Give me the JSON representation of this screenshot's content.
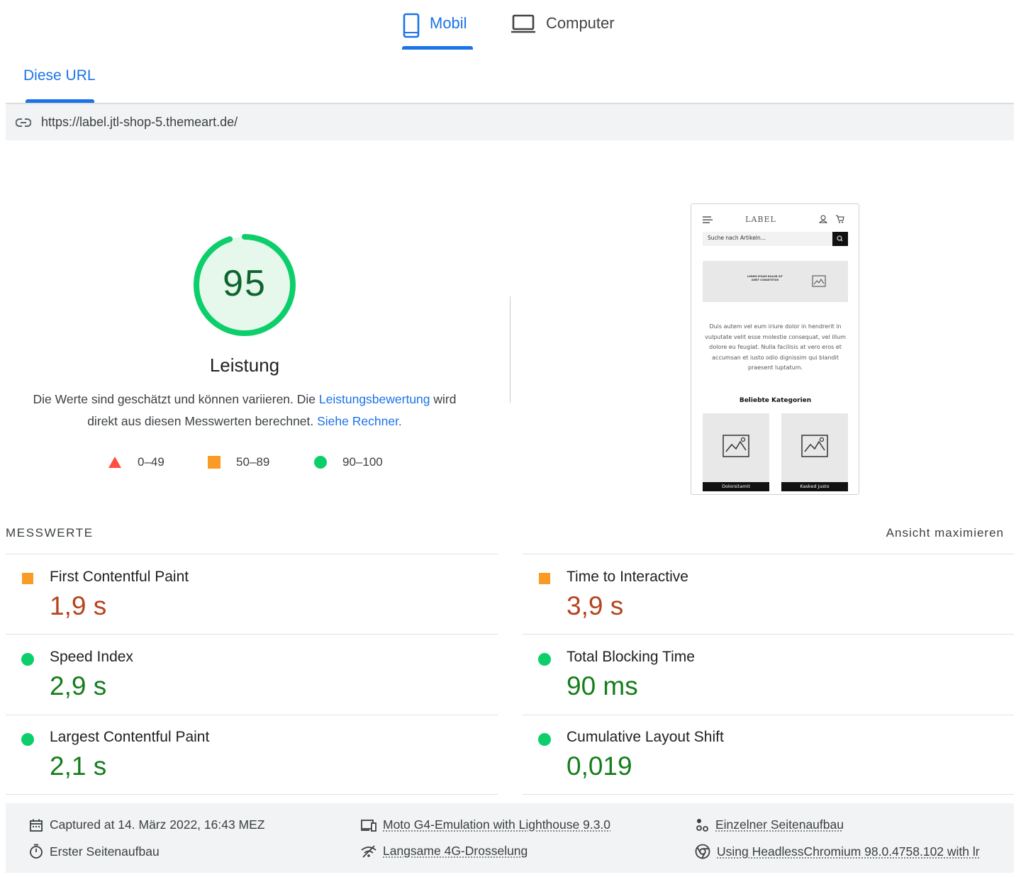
{
  "device_tabs": {
    "mobile_label": "Mobil",
    "computer_label": "Computer",
    "active": "mobile"
  },
  "url_tab": {
    "label": "Diese URL"
  },
  "url_bar": {
    "url": "https://label.jtl-shop-5.themeart.de/"
  },
  "score": {
    "value": "95",
    "title": "Leistung",
    "desc_part1": "Die Werte sind geschätzt und können variieren. Die ",
    "desc_link1": "Leistungsbewertung",
    "desc_part2": " wird direkt aus diesen Messwerten berechnet. ",
    "desc_link2": "Siehe Rechner.",
    "gauge_fraction": 0.95,
    "color": "#0cce6b"
  },
  "legend": [
    {
      "range": "0–49",
      "icon": "triangle-icon",
      "color": "#ff4e42"
    },
    {
      "range": "50–89",
      "icon": "square-icon",
      "color": "#fa9b26"
    },
    {
      "range": "90–100",
      "icon": "circle-icon",
      "color": "#0cce6b"
    }
  ],
  "preview": {
    "logo": "LABEL",
    "search_placeholder": "Suche nach Artikeln...",
    "banner_text": "LOREM IPSUM DOLOR SIT AMET CONSETETUR",
    "body_text": "Duis autem vel eum iriure dolor in hendrerit in vulputate velit esse molestie consequat, vel illum dolore eu feugiat. Nulla facilisis at vero eros et accumsan et iusto odio dignissim qui blandit praesent luptatum.",
    "categories_title": "Beliebte Kategorien",
    "categories": [
      "Dolorsitamit",
      "Kasked Justo"
    ]
  },
  "metrics": {
    "heading": "MESSWERTE",
    "maximize_label": "Ansicht maximieren",
    "items": [
      {
        "name": "First Contentful Paint",
        "value": "1,9 s",
        "rating": "average"
      },
      {
        "name": "Time to Interactive",
        "value": "3,9 s",
        "rating": "average"
      },
      {
        "name": "Speed Index",
        "value": "2,9 s",
        "rating": "pass"
      },
      {
        "name": "Total Blocking Time",
        "value": "90 ms",
        "rating": "pass"
      },
      {
        "name": "Largest Contentful Paint",
        "value": "2,1 s",
        "rating": "pass"
      },
      {
        "name": "Cumulative Layout Shift",
        "value": "0,019",
        "rating": "pass"
      }
    ]
  },
  "footer": {
    "captured": "Captured at 14. März 2022, 16:43 MEZ",
    "first_load": "Erster Seitenaufbau",
    "emulation": "Moto G4-Emulation with Lighthouse 9.3.0",
    "throttling": "Langsame 4G-Drosselung",
    "single_load": "Einzelner Seitenaufbau",
    "browser": "Using HeadlessChromium 98.0.4758.102 with lr"
  },
  "colors": {
    "accent": "#1a73e8",
    "pass": "#0cce6b",
    "average": "#fa9b26",
    "fail": "#ff4e42"
  }
}
